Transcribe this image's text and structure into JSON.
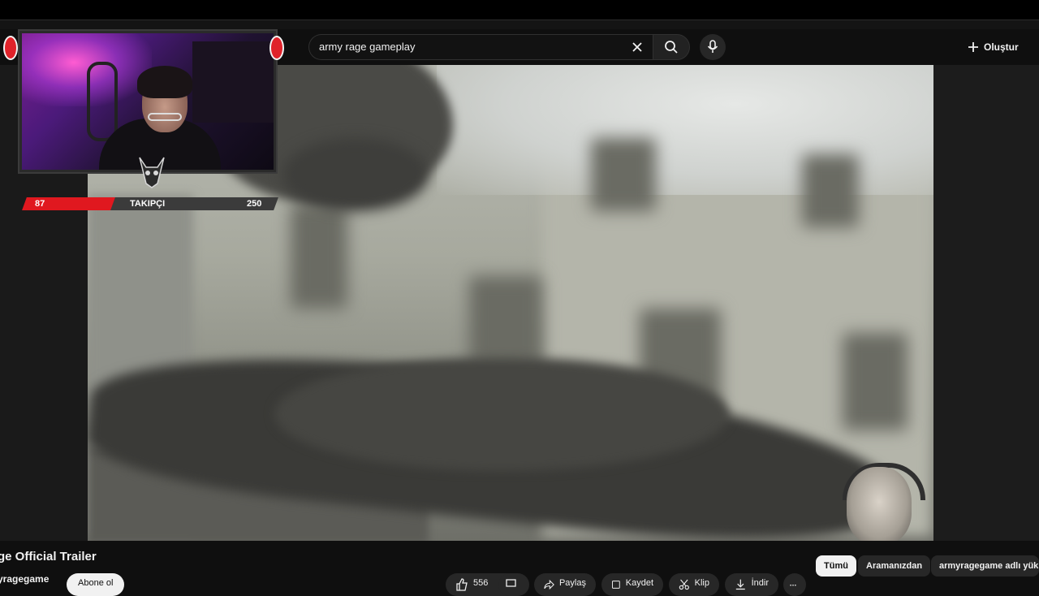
{
  "search": {
    "query": "army rage gameplay"
  },
  "header": {
    "create_label": "Oluştur"
  },
  "overlay": {
    "followers_current": "87",
    "followers_label": "TAKIPÇI",
    "followers_goal": "250",
    "progress_fraction": 0.35
  },
  "video": {
    "title": "ge Official Trailer",
    "channel": "yragegame",
    "subscribe_label": "Abone ol",
    "actions": {
      "likes": "556",
      "share": "Paylaş",
      "save": "Kaydet",
      "clip": "Klip",
      "download": "İndir"
    }
  },
  "chips": [
    {
      "label": "Tümü",
      "active": true
    },
    {
      "label": "Aramanızdan",
      "active": false
    },
    {
      "label": "armyragegame adlı yük",
      "active": false
    }
  ],
  "colors": {
    "background": "#0f0f0f",
    "accent_red": "#e0181f",
    "chip_bg": "#272727"
  }
}
